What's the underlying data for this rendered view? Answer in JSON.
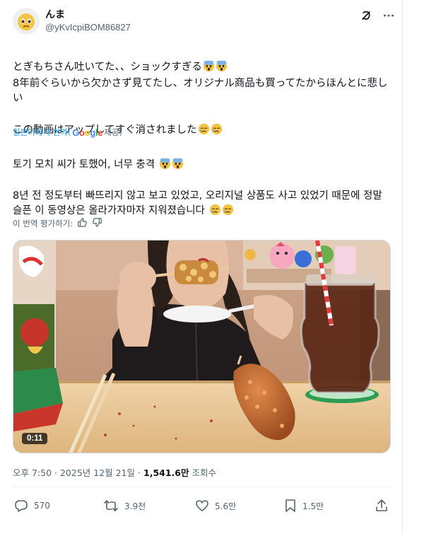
{
  "author": {
    "name": "んま",
    "handle": "@yKvIcpiBOM86827"
  },
  "original": {
    "line1": "とぎもちさん吐いてた、、ショックすぎる",
    "line2": "8年前ぐらいから欠かさず見てたし、オリジナル商品も買ってたからほんとに悲しい",
    "line3": "この動画はアップしてすぐ消されました"
  },
  "translation_bar": {
    "prefix": "일본어에서 번역(",
    "google": [
      "G",
      "o",
      "o",
      "g",
      "l",
      "e"
    ],
    "suffix": " 제공)"
  },
  "translated": {
    "line1": "토기 모치 씨가 토했어, 너무 충격",
    "line2": "8년 전 정도부터 빠뜨리지 않고 보고 있었고, 오리지널 상품도 사고 있었기 때문에 정말 슬픈 이 동영상은 올라가자마자 지워졌습니다"
  },
  "rate_translation": "이 번역 평가하기:",
  "media": {
    "duration": "0:11"
  },
  "meta": {
    "time": "오후 7:50",
    "date": "2025년 12월 21일",
    "views": "1,541.6만",
    "views_label": " 조회수"
  },
  "actions": {
    "replies": "570",
    "reposts": "3.9천",
    "likes": "5.6만",
    "bookmarks": "1.5만"
  },
  "icons": [
    "grok-icon",
    "more-icon",
    "thumbs-up-icon",
    "thumbs-down-icon",
    "reply-icon",
    "repost-icon",
    "like-icon",
    "bookmark-icon",
    "share-icon",
    "fearful-emoji",
    "crying-emoji"
  ]
}
